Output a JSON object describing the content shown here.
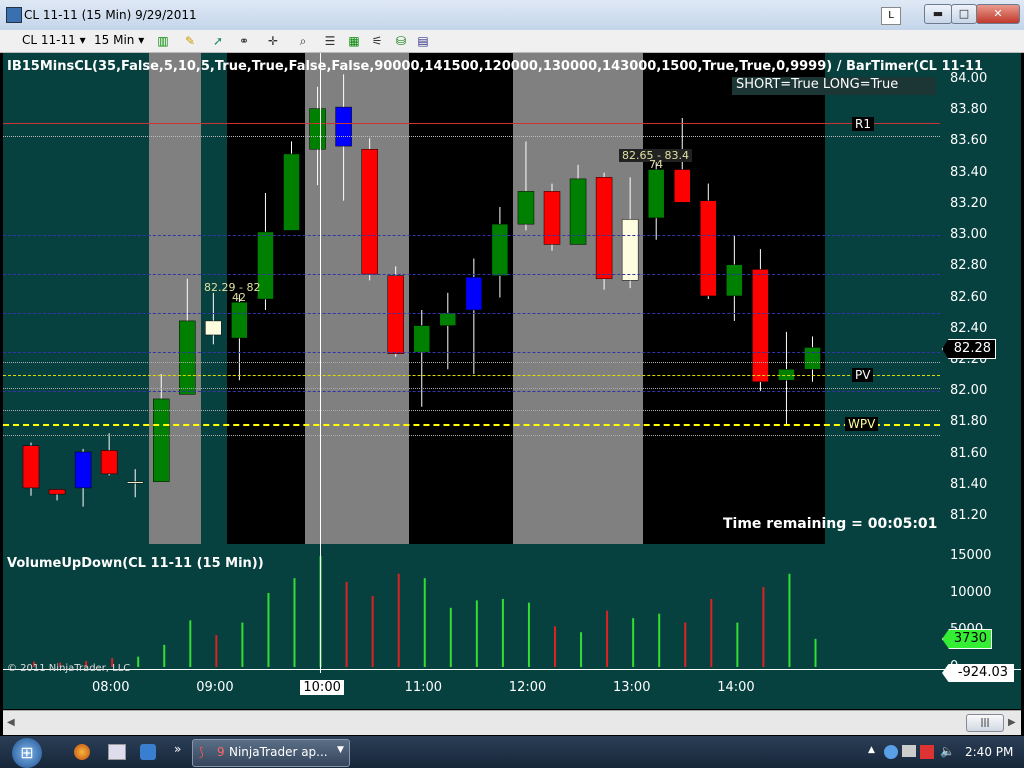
{
  "window": {
    "title": "CL 11-11 (15 Min)  9/29/2011",
    "l_button": "L",
    "min_glyph": "▬",
    "max_glyph": "□",
    "close_glyph": "✕"
  },
  "toolbar": {
    "instrument": "CL 11-11",
    "interval": "15 Min",
    "dropdown_glyph": "▾",
    "icons": [
      "bar-type-icon",
      "draw-pencil-icon",
      "pointer-icon",
      "link-icon",
      "crosshair-icon",
      "zoom-icon",
      "data-box-icon",
      "chart-style-icon",
      "indicators-icon",
      "strategies-icon",
      "properties-icon"
    ]
  },
  "chart": {
    "indicator_label": "IB15MinsCL(35,False,5,10,5,True,True,False,False,90000,141500,120000,130000,143000,1500,True,True,0,9999)  /  BarTimer(CL  11-11",
    "short_long": "SHORT=True LONG=True",
    "time_remaining": "Time remaining = 00:05:01",
    "label_r1": "R1",
    "label_pv": "PV",
    "label_wpv": "WPV",
    "ann_1": "82.29 - 82",
    "ann_2": "42",
    "ann_3": "82.65 - 83.4",
    "ann_4": "74",
    "current_price": "82.28",
    "price_ticks": [
      "84.00",
      "83.80",
      "83.60",
      "83.40",
      "83.20",
      "83.00",
      "82.80",
      "82.60",
      "82.40",
      "82.20",
      "82.00",
      "81.80",
      "81.60",
      "81.40",
      "81.20"
    ],
    "vol_label": "VolumeUpDown(CL 11-11 (15 Min))",
    "vol_ticks": [
      "15000",
      "10000",
      "5000",
      "0"
    ],
    "vol_current": "3730",
    "footer_value": "-924.03",
    "copyright": "© 2011 NinjaTrader, LLC",
    "time_ticks": [
      "08:00",
      "09:00",
      "10:00",
      "11:00",
      "12:00",
      "13:00",
      "14:00"
    ]
  },
  "chart_data": {
    "type": "candlestick",
    "title": "CL 11-11 (15 Min)",
    "colors": {
      "up": "#008000",
      "down": "#ff0000",
      "neutral_up": "#0000ff",
      "neutral": "#fffde0",
      "volume_up": "#33dd33",
      "volume_down": "#dd2222"
    },
    "ylim": [
      81.1,
      84.1
    ],
    "levels": {
      "R1": 83.72,
      "PV": 82.1,
      "WPV": 81.8
    },
    "candles": [
      {
        "t": "07:45",
        "open": 81.65,
        "close": 81.38,
        "high": 81.67,
        "low": 81.33,
        "color": "down"
      },
      {
        "t": "07:45",
        "open": 81.37,
        "close": 81.34,
        "high": 81.37,
        "low": 81.3,
        "color": "down"
      },
      {
        "t": "07:45",
        "open": 81.61,
        "close": 81.38,
        "high": 81.63,
        "low": 81.26,
        "color": "blue"
      },
      {
        "t": "08:00",
        "open": 81.62,
        "close": 81.47,
        "high": 81.73,
        "low": 81.46,
        "color": "down"
      },
      {
        "t": "08:15",
        "open": 81.42,
        "close": 81.42,
        "high": 81.5,
        "low": 81.32,
        "color": "neutral"
      },
      {
        "t": "08:30",
        "open": 81.42,
        "close": 81.95,
        "high": 82.11,
        "low": 81.42,
        "color": "up"
      },
      {
        "t": "08:45",
        "open": 81.98,
        "close": 82.45,
        "high": 82.72,
        "low": 81.98,
        "color": "up"
      },
      {
        "t": "09:00",
        "open": 82.36,
        "close": 82.45,
        "high": 82.63,
        "low": 82.3,
        "color": "neutral"
      },
      {
        "t": "09:15",
        "open": 82.34,
        "close": 82.57,
        "high": 82.62,
        "low": 82.07,
        "color": "up"
      },
      {
        "t": "09:30",
        "open": 82.59,
        "close": 83.02,
        "high": 83.27,
        "low": 82.52,
        "color": "up"
      },
      {
        "t": "09:45",
        "open": 83.03,
        "close": 83.52,
        "high": 83.6,
        "low": 83.03,
        "color": "up"
      },
      {
        "t": "10:00",
        "open": 83.55,
        "close": 83.81,
        "high": 83.95,
        "low": 83.32,
        "color": "up"
      },
      {
        "t": "10:15",
        "open": 83.82,
        "close": 83.57,
        "high": 84.03,
        "low": 83.22,
        "color": "blue"
      },
      {
        "t": "10:30",
        "open": 83.55,
        "close": 82.75,
        "high": 83.62,
        "low": 82.71,
        "color": "down"
      },
      {
        "t": "10:45",
        "open": 82.74,
        "close": 82.24,
        "high": 82.8,
        "low": 82.22,
        "color": "down"
      },
      {
        "t": "11:00",
        "open": 82.25,
        "close": 82.42,
        "high": 82.52,
        "low": 81.9,
        "color": "up"
      },
      {
        "t": "11:15",
        "open": 82.42,
        "close": 82.5,
        "high": 82.63,
        "low": 82.14,
        "color": "up"
      },
      {
        "t": "11:30",
        "open": 82.52,
        "close": 82.73,
        "high": 82.85,
        "low": 82.11,
        "color": "blue"
      },
      {
        "t": "11:45",
        "open": 82.74,
        "close": 83.07,
        "high": 83.18,
        "low": 82.6,
        "color": "up"
      },
      {
        "t": "12:00",
        "open": 83.07,
        "close": 83.28,
        "high": 83.6,
        "low": 83.03,
        "color": "up"
      },
      {
        "t": "12:15",
        "open": 83.28,
        "close": 82.94,
        "high": 83.33,
        "low": 82.9,
        "color": "down"
      },
      {
        "t": "12:30",
        "open": 82.94,
        "close": 83.36,
        "high": 83.45,
        "low": 82.94,
        "color": "up"
      },
      {
        "t": "12:45",
        "open": 83.37,
        "close": 82.72,
        "high": 83.4,
        "low": 82.65,
        "color": "down"
      },
      {
        "t": "13:00",
        "open": 82.71,
        "close": 83.1,
        "high": 83.37,
        "low": 82.66,
        "color": "neutral"
      },
      {
        "t": "13:15",
        "open": 83.11,
        "close": 83.42,
        "high": 83.5,
        "low": 82.97,
        "color": "up"
      },
      {
        "t": "13:30",
        "open": 83.42,
        "close": 83.21,
        "high": 83.75,
        "low": 83.21,
        "color": "down"
      },
      {
        "t": "13:45",
        "open": 83.22,
        "close": 82.61,
        "high": 83.33,
        "low": 82.59,
        "color": "down"
      },
      {
        "t": "14:00",
        "open": 82.61,
        "close": 82.81,
        "high": 83.0,
        "low": 82.45,
        "color": "up"
      },
      {
        "t": "14:15",
        "open": 82.78,
        "close": 82.06,
        "high": 82.91,
        "low": 82.0,
        "color": "down"
      },
      {
        "t": "14:30",
        "open": 82.07,
        "close": 82.14,
        "high": 82.38,
        "low": 81.78,
        "color": "up"
      },
      {
        "t": "14:45",
        "open": 82.14,
        "close": 82.28,
        "high": 82.35,
        "low": 82.06,
        "color": "up"
      }
    ],
    "volume": [
      {
        "v": 700,
        "color": "down"
      },
      {
        "v": 600,
        "color": "down"
      },
      {
        "v": 800,
        "color": "down"
      },
      {
        "v": 1200,
        "color": "down"
      },
      {
        "v": 1400,
        "color": "up"
      },
      {
        "v": 3000,
        "color": "up"
      },
      {
        "v": 6300,
        "color": "up"
      },
      {
        "v": 4300,
        "color": "down"
      },
      {
        "v": 6000,
        "color": "up"
      },
      {
        "v": 10000,
        "color": "up"
      },
      {
        "v": 12000,
        "color": "up"
      },
      {
        "v": 15000,
        "color": "up"
      },
      {
        "v": 11500,
        "color": "down"
      },
      {
        "v": 9600,
        "color": "down"
      },
      {
        "v": 12600,
        "color": "down"
      },
      {
        "v": 12000,
        "color": "up"
      },
      {
        "v": 8000,
        "color": "up"
      },
      {
        "v": 9000,
        "color": "up"
      },
      {
        "v": 9200,
        "color": "up"
      },
      {
        "v": 8700,
        "color": "up"
      },
      {
        "v": 5500,
        "color": "down"
      },
      {
        "v": 4700,
        "color": "up"
      },
      {
        "v": 7600,
        "color": "down"
      },
      {
        "v": 6600,
        "color": "up"
      },
      {
        "v": 7200,
        "color": "up"
      },
      {
        "v": 6000,
        "color": "down"
      },
      {
        "v": 9200,
        "color": "down"
      },
      {
        "v": 6000,
        "color": "up"
      },
      {
        "v": 10800,
        "color": "down"
      },
      {
        "v": 12600,
        "color": "up"
      },
      {
        "v": 3800,
        "color": "up"
      }
    ],
    "vol_ylim": [
      0,
      15500
    ]
  },
  "taskbar": {
    "start": "⊞",
    "app_label": "NinjaTrader ap...",
    "app_count": "9",
    "more": "»",
    "clock": "2:40 PM"
  }
}
